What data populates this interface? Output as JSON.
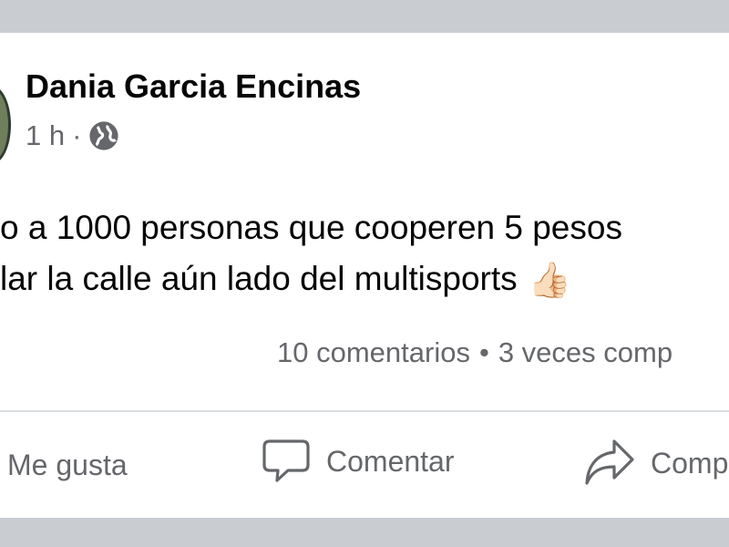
{
  "post": {
    "author": "Dania Garcia Encinas",
    "time": "1 h",
    "meta_separator": "·",
    "privacy_icon": "globe-icon",
    "text_line1": "o a 1000 personas que cooperen 5 pesos",
    "text_line2": "lar la calle aún lado del multisports",
    "emoji": "👍🏻"
  },
  "stats": {
    "comments": "10 comentarios",
    "separator": "•",
    "shares": "3 veces comp"
  },
  "actions": {
    "like": "Me gusta",
    "comment": "Comentar",
    "share": "Comp"
  },
  "colors": {
    "background": "#c9ccd1",
    "card": "#ffffff",
    "text": "#050505",
    "secondary_text": "#65676b"
  }
}
